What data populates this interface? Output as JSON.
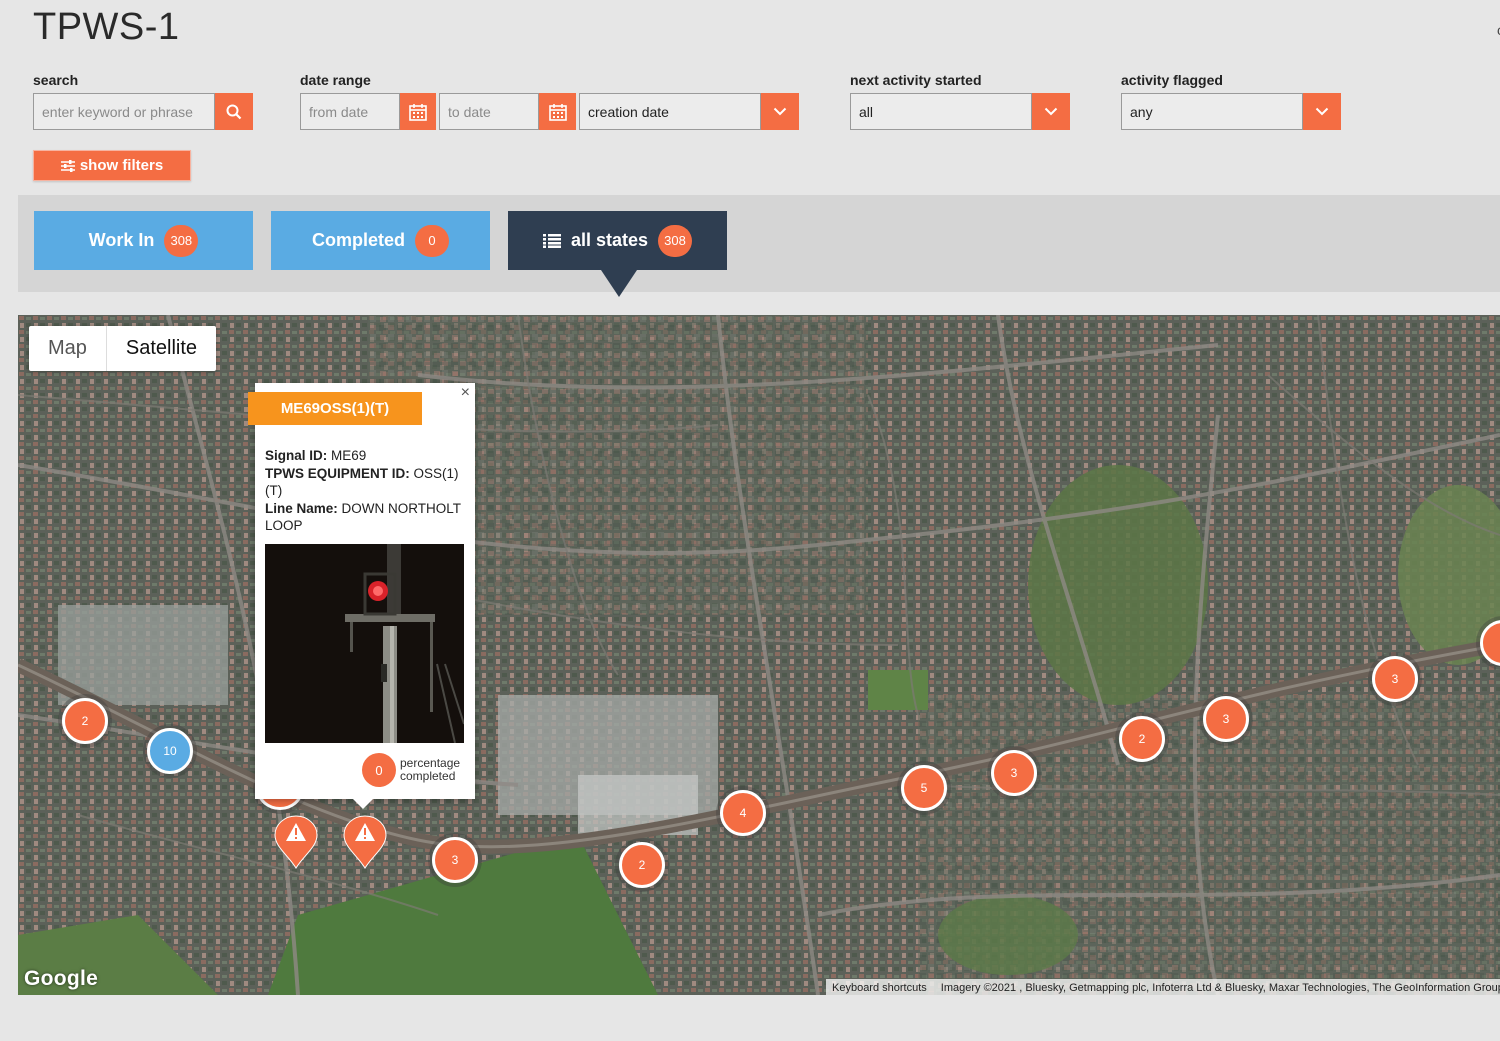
{
  "app": {
    "title": "TPWS-1",
    "edge_char": "c"
  },
  "filters": {
    "search": {
      "label": "search",
      "placeholder": "enter keyword or phrase"
    },
    "date_range": {
      "label": "date range",
      "from_placeholder": "from date",
      "to_placeholder": "to date",
      "type_value": "creation date"
    },
    "next_activity": {
      "label": "next activity started",
      "value": "all"
    },
    "activity_flagged": {
      "label": "activity flagged",
      "value": "any"
    },
    "show_filters_label": "show filters"
  },
  "state_tabs": [
    {
      "label": "Work In",
      "count": "308"
    },
    {
      "label": "Completed",
      "count": "0"
    },
    {
      "label": "all states",
      "count": "308"
    }
  ],
  "map": {
    "type_buttons": {
      "map": "Map",
      "satellite": "Satellite"
    },
    "clusters": [
      "2",
      "10",
      "3",
      "2",
      "4",
      "5",
      "3",
      "2",
      "3",
      "3"
    ],
    "popup": {
      "title": "ME69OSS(1)(T)",
      "close": "×",
      "signal_id_label": "Signal ID:",
      "signal_id": "ME69",
      "equipment_label": "TPWS EQUIPMENT ID:",
      "equipment_id": "OSS(1) (T)",
      "line_name_label": "Line Name:",
      "line_name": "DOWN NORTHOLT LOOP",
      "percentage": "0",
      "percentage_label_1": "percentage",
      "percentage_label_2": "completed"
    },
    "google_logo": "Google",
    "keyboard_shortcuts": "Keyboard shortcuts",
    "imagery": "Imagery ©2021 , Bluesky, Getmapping plc, Infoterra Ltd & Bluesky, Maxar Technologies, The GeoInformation Group"
  },
  "colors": {
    "accent": "#f46d43",
    "tab_blue": "#5aabe3",
    "tab_dark": "#2f3e51",
    "popup_title": "#f7941d"
  },
  "icons": [
    "search-icon",
    "calendar-icon",
    "chevron-down-icon",
    "sliders-icon",
    "list-icon",
    "warning-icon",
    "close-icon"
  ]
}
